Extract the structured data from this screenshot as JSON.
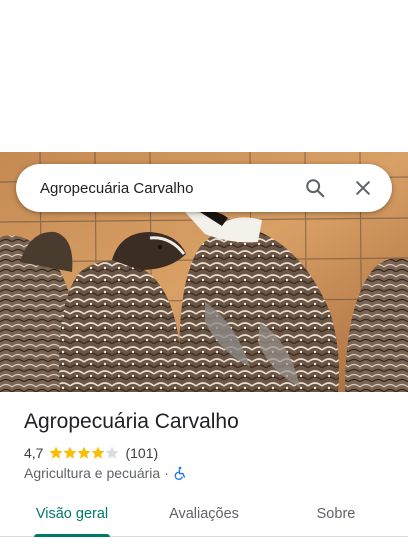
{
  "search": {
    "query": "Agropecuária Carvalho"
  },
  "place": {
    "name": "Agropecuária Carvalho",
    "rating": "4,7",
    "stars_value": 4.7,
    "reviews_count": "(101)",
    "category": "Agricultura e pecuária",
    "separator": "·"
  },
  "tabs": [
    {
      "label": "Visão geral",
      "active": true
    },
    {
      "label": "Avaliações",
      "active": false
    },
    {
      "label": "Sobre",
      "active": false
    }
  ],
  "colors": {
    "accent": "#00796b",
    "star": "#fbbc04",
    "accessibility": "#1a73e8"
  }
}
